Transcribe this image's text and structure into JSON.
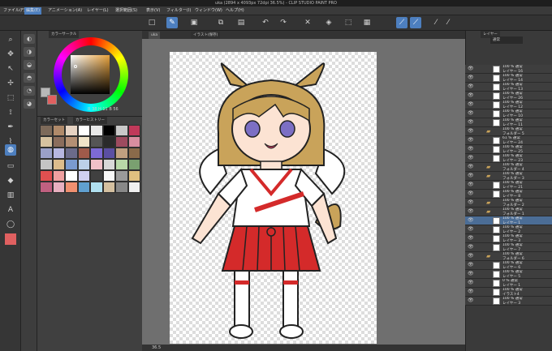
{
  "title": "uka (2894 x 4093px 72dpi 36.5%) - CLIP STUDIO PAINT PRO",
  "menu": [
    "ファイル(F)",
    "編集(E)",
    "アニメーション(A)",
    "レイヤー(L)",
    "選択範囲(S)",
    "表示(V)",
    "フィルター(I)",
    "ウィンドウ(W)",
    "ヘルプ(H)"
  ],
  "panels": {
    "color_wheel_tab": "カラーサークル",
    "palette_tab_1": "カラーセット",
    "palette_tab_2": "カラーヒストリー",
    "layer_tab": "レイヤー",
    "blend_mode": "通常",
    "canvas_tab": "uka",
    "canvas_tab_2": "イラスト(保存)"
  },
  "color_readout": "R 38  H 11  B 56",
  "status": {
    "zoom": "36.5"
  },
  "palette": [
    "#7d6a5a",
    "#b08a6a",
    "#e6d3c3",
    "#ffffff",
    "#e8e8e8",
    "#000000",
    "#c9c9c9",
    "#c0395a",
    "#d6c2a0",
    "#8b6d5c",
    "#b38f74",
    "#f0e3c8",
    "#555555",
    "#2a2a2a",
    "#9e4b5f",
    "#d88ea0",
    "#9aa0c8",
    "#b7b7e0",
    "#6b6b8a",
    "#a05a4a",
    "#7d6ad6",
    "#5b4fa3",
    "#c0a080",
    "#8a6a4a",
    "#c4c4c4",
    "#dcbc8c",
    "#7a9ad0",
    "#bcd0e8",
    "#f0c0c8",
    "#d8d8d8",
    "#b8d8a8",
    "#7aa070",
    "#e05050",
    "#f0a0a0",
    "#ffffff",
    "#d0d0f0",
    "#404040",
    "#f8f8f8",
    "#9a9a9a",
    "#e0c080",
    "#c06080",
    "#e8b0c0",
    "#f09070",
    "#60a0d0",
    "#b0e0f0",
    "#d4c0a0",
    "#888888",
    "#f0f0f0"
  ],
  "layers": [
    {
      "name": "100 % 通常\nレイヤー 16",
      "type": "layer"
    },
    {
      "name": "100 % 通常\nレイヤー 14",
      "type": "layer"
    },
    {
      "name": "100 % 通常\nレイヤー 13",
      "type": "layer"
    },
    {
      "name": "100 % 通常\nレイヤー 26",
      "type": "layer"
    },
    {
      "name": "100 % 通常\nレイヤー 12",
      "type": "layer"
    },
    {
      "name": "100 % 通常\nレイヤー 10",
      "type": "layer"
    },
    {
      "name": "100 % 通常\nレイヤー 11",
      "type": "layer"
    },
    {
      "name": "100 % 通常\nフォルダー 5",
      "type": "folder"
    },
    {
      "name": "61 % 通常\nレイヤー 24",
      "type": "layer"
    },
    {
      "name": "100 % 通常\nレイヤー 25",
      "type": "layer"
    },
    {
      "name": "100 % 通常\nレイヤー 23",
      "type": "layer"
    },
    {
      "name": "100 % 通常\nフォルダー 4",
      "type": "folder"
    },
    {
      "name": "100 % 通常\nフォルダー 3",
      "type": "folder"
    },
    {
      "name": "100 % 通常\nレイヤー 21",
      "type": "layer"
    },
    {
      "name": "100 % 通常\nレイヤー 8",
      "type": "layer"
    },
    {
      "name": "100 % 通常\nフォルダー 2",
      "type": "folder"
    },
    {
      "name": "100 % 通常\nフォルダー 1",
      "type": "folder"
    },
    {
      "name": "100 % 通常\nレイヤー 1",
      "type": "layer",
      "selected": true
    },
    {
      "name": "100 % 通常\nレイヤー 2",
      "type": "layer"
    },
    {
      "name": "100 % 通常\nレイヤー 3",
      "type": "layer"
    },
    {
      "name": "100 % 通常\nレイヤー 7",
      "type": "layer"
    },
    {
      "name": "100 % 通常\nフォルダー 6",
      "type": "folder"
    },
    {
      "name": "100 % 通常\nレイヤー 6",
      "type": "layer"
    },
    {
      "name": "100 % 通常\nレイヤー 5",
      "type": "layer"
    },
    {
      "name": "0 % 通常\nレイヤー 1",
      "type": "layer"
    },
    {
      "name": "100 % 通常\nイラスト4",
      "type": "layer"
    },
    {
      "name": "100 % 通常\nレイヤー 3",
      "type": "layer"
    }
  ],
  "colors": {
    "accent": "#4d7fbf",
    "hair": "#c9a35a",
    "skirt": "#d42a2a"
  }
}
